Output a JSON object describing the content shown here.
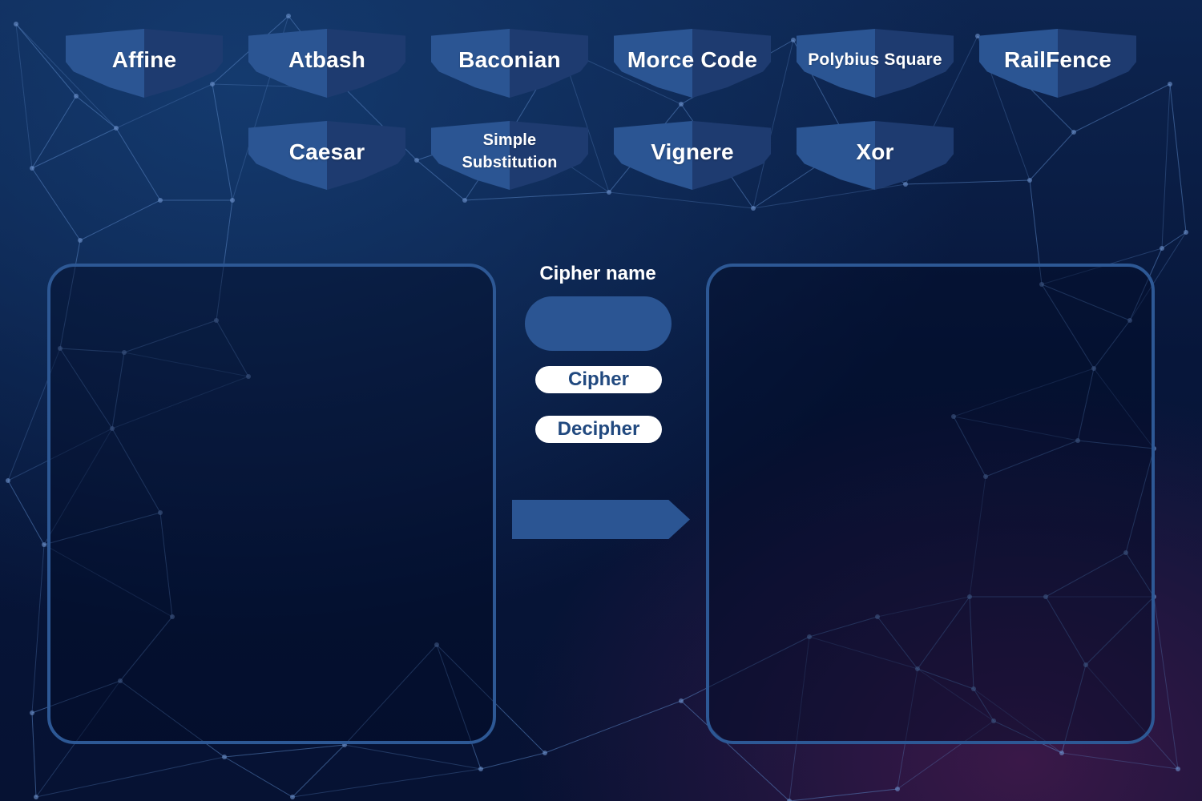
{
  "cipher_buttons_row1": [
    {
      "label": "Affine"
    },
    {
      "label": "Atbash"
    },
    {
      "label": "Baconian"
    },
    {
      "label": "Morce Code"
    },
    {
      "label": "Polybius Square"
    },
    {
      "label": "RailFence"
    }
  ],
  "cipher_buttons_row2": [
    {
      "label": "Caesar"
    },
    {
      "label": "Simple\nSubstitution"
    },
    {
      "label": "Vignere"
    },
    {
      "label": "Xor"
    }
  ],
  "center": {
    "cipher_name_label": "Cipher name",
    "cipher_name_value": "",
    "cipher_button": "Cipher",
    "decipher_button": "Decipher"
  },
  "panels": {
    "input_text": "",
    "output_text": ""
  },
  "colors": {
    "accent": "#2b5593",
    "accent_dark": "#1e3b70",
    "panel_border": "#2d5895",
    "button_text": "#21497f"
  },
  "icons": {
    "convert_arrow": "arrow-right-icon"
  }
}
